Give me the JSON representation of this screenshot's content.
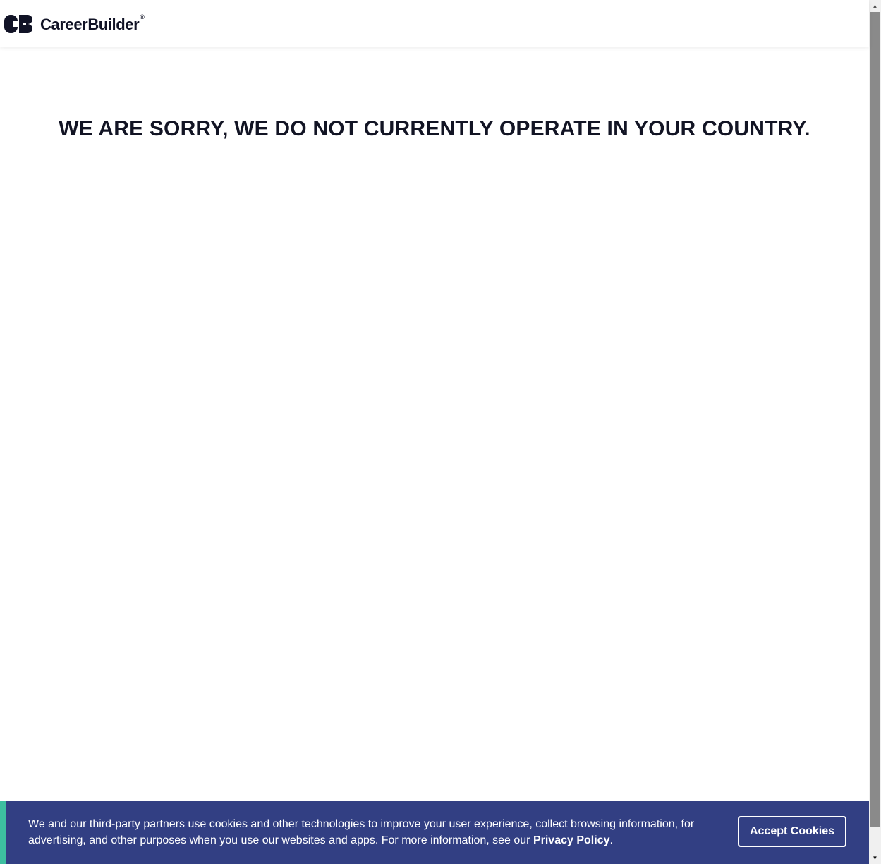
{
  "header": {
    "logo_text": "CareerBuilder",
    "logo_registered": "®",
    "logo_icon": "careerbuilder-cb-logo-icon"
  },
  "main": {
    "message": "WE ARE SORRY, WE DO NOT CURRENTLY OPERATE IN YOUR COUNTRY."
  },
  "cookie_banner": {
    "text_before_link": "We and our third-party partners use cookies and other technologies to improve your user experience, collect browsing information, for advertising, and other purposes when you use our websites and apps. For more information, see our ",
    "link_label": "Privacy Policy",
    "text_after_link": ".",
    "accept_label": "Accept Cookies",
    "colors": {
      "background": "#323f83",
      "accent": "#3dbfa0",
      "text": "#ffffff"
    }
  },
  "scrollbar": {
    "up_arrow": "▲",
    "down_arrow": "▼"
  }
}
